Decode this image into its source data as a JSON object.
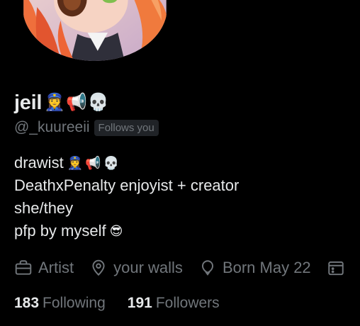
{
  "profile": {
    "display_name": "jeil",
    "name_emojis": [
      "👮‍♀️",
      "📢",
      "💀"
    ],
    "handle": "@_kuureeii",
    "follows_badge": "Follows you"
  },
  "bio": {
    "line1_text": "drawist",
    "line1_emojis": [
      "👮‍♀️",
      "📢",
      "💀"
    ],
    "line2_text": "DeathxPenalty enjoyist + creator",
    "line3_text": "she/they",
    "line4_text": "pfp by myself",
    "line4_emoji": "😎"
  },
  "meta": {
    "profession": "Artist",
    "location": "your walls",
    "birthday": "Born May 22"
  },
  "stats": {
    "following_count": "183",
    "following_label": "Following",
    "followers_count": "191",
    "followers_label": "Followers"
  },
  "icons": {
    "profession": "briefcase-icon",
    "location": "location-pin-icon",
    "birthday": "balloon-icon",
    "joined": "calendar-icon"
  },
  "colors": {
    "background": "#000000",
    "primary_text": "#e7e9ea",
    "secondary_text": "#71767b",
    "badge_bg": "#202327"
  }
}
